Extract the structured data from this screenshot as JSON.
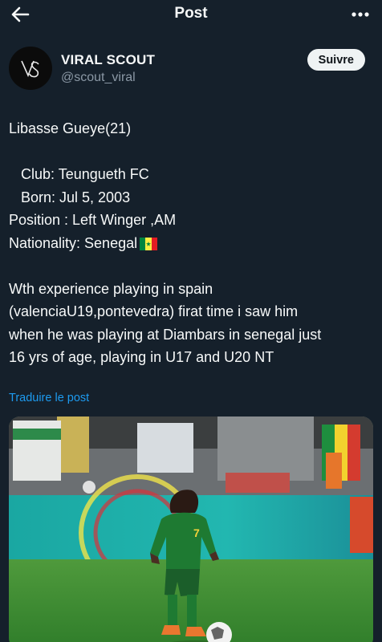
{
  "header": {
    "title": "Post",
    "back_icon": "arrow-left-icon",
    "more_icon": "more-horizontal-icon"
  },
  "author": {
    "name": "VIRAL SCOUT",
    "handle": "@scout_viral",
    "avatar_monogram": "VS",
    "follow_label": "Suivre"
  },
  "post": {
    "lines": [
      "Libasse Gueye(21)",
      "",
      "   Club: Teungueth FC",
      "   Born: Jul 5, 2003",
      "Position : Left Winger ,AM",
      "Nationality: Senegal",
      "",
      "Wth experience playing in spain",
      "(valenciaU19,pontevedra) firat time i saw him",
      "when he was playing at Diambars in senegal just",
      "16 yrs of age, playing in U17 and U20 NT"
    ],
    "flag_emoji": "senegal-flag-icon",
    "flag_colors": [
      "#00853f",
      "#fdef42",
      "#e31b23"
    ],
    "translate_label": "Traduire le post"
  },
  "media": {
    "kind": "photo",
    "description_icon": "football-player-photo",
    "jersey_number": "7"
  },
  "colors": {
    "background": "#15202b",
    "text": "#f7f9f9",
    "muted": "#8b98a5",
    "link": "#1d9bf0",
    "follow_bg": "#eff3f4"
  }
}
